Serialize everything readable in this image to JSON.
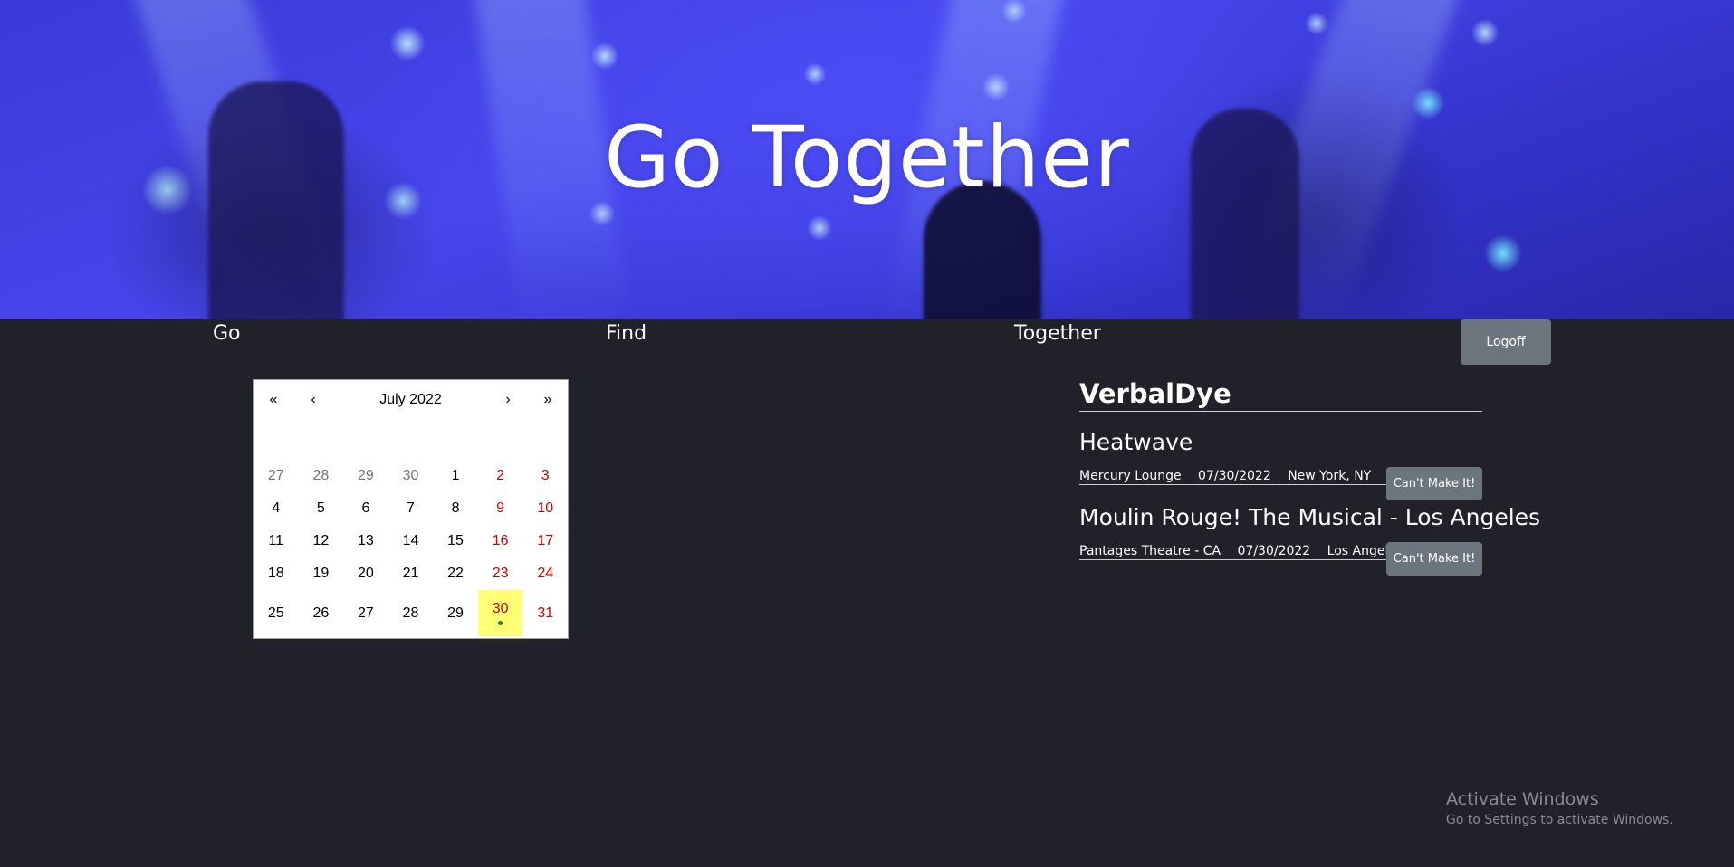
{
  "hero": {
    "title": "Go Together"
  },
  "nav": {
    "items": [
      {
        "label": "Go"
      },
      {
        "label": "Find"
      },
      {
        "label": "Together"
      }
    ],
    "logoff_label": "Logoff"
  },
  "calendar": {
    "nav": {
      "first": "«",
      "prev": "‹",
      "next": "›",
      "last": "»"
    },
    "month_label": "July 2022",
    "selected_day": "30",
    "weeks": [
      [
        "27",
        "28",
        "29",
        "30",
        "1",
        "2",
        "3"
      ],
      [
        "4",
        "5",
        "6",
        "7",
        "8",
        "9",
        "10"
      ],
      [
        "11",
        "12",
        "13",
        "14",
        "15",
        "16",
        "17"
      ],
      [
        "18",
        "19",
        "20",
        "21",
        "22",
        "23",
        "24"
      ],
      [
        "25",
        "26",
        "27",
        "28",
        "29",
        "30",
        "31"
      ]
    ],
    "colors": {
      "weekend": "#d10000",
      "neighbor": "#757575",
      "highlight": "#ffff76",
      "event_dot": "#1a8a3a"
    }
  },
  "profile": {
    "username": "VerbalDye"
  },
  "events": [
    {
      "name": "Heatwave",
      "venue": "Mercury Lounge",
      "date": "07/30/2022",
      "location": "New York, NY",
      "button_label": "Can't Make It!"
    },
    {
      "name": "Moulin Rouge! The Musical - Los Angeles",
      "venue": "Pantages Theatre - CA",
      "date": "07/30/2022",
      "location": "Los Angeles, CA",
      "button_label": "Can't Make It!"
    }
  ],
  "watermark": {
    "line1": "Activate Windows",
    "line2": "Go to Settings to activate Windows."
  },
  "theme": {
    "background": "#21212a",
    "button": "#6c757d"
  }
}
